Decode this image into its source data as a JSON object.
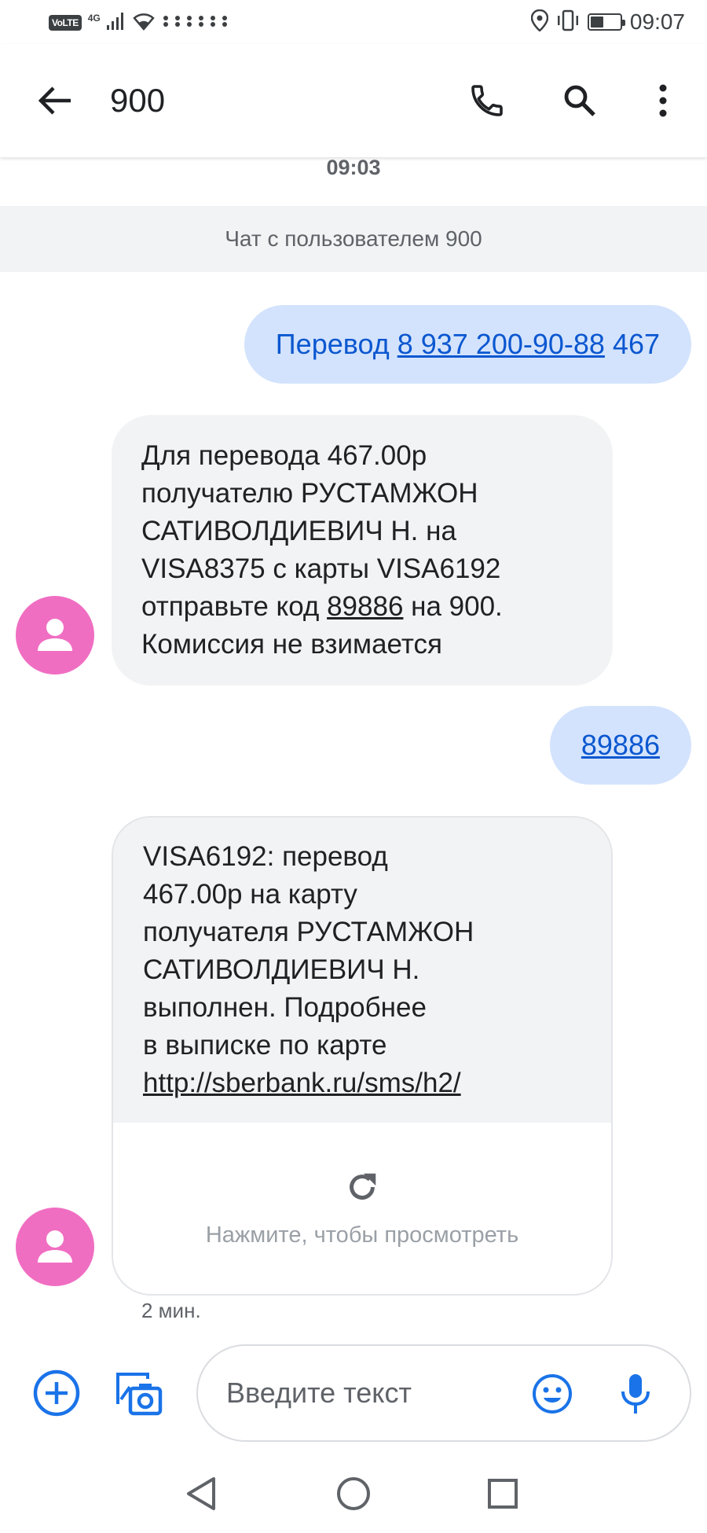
{
  "status_bar": {
    "volte": "VoLTE",
    "network": "4G",
    "time": "09:07",
    "battery_level": 0.45
  },
  "header": {
    "title": "900"
  },
  "conversation": {
    "timestamp_top": "09:03",
    "banner": "Чат с пользователем 900",
    "messages": [
      {
        "direction": "outgoing",
        "prefix": "Перевод ",
        "link": "8 937 200-90-88",
        "suffix": " 467"
      },
      {
        "direction": "incoming",
        "lines": [
          "Для перевода 467.00р",
          "получателю РУСТАМЖОН",
          "САТИВОЛДИЕВИЧ Н. на",
          "VISA8375 с карты VISA6192"
        ],
        "code_prefix": "отправьте код ",
        "code": "89886",
        "code_suffix": " на 900.",
        "last_line": "Комиссия не взимается"
      },
      {
        "direction": "outgoing",
        "link": "89886"
      },
      {
        "direction": "incoming",
        "lines": [
          "VISA6192: перевод",
          "467.00р на карту",
          "получателя РУСТАМЖОН",
          "САТИВОЛДИЕВИЧ Н.",
          "выполнен. Подробнее",
          "в выписке по карте"
        ],
        "url": "http://sberbank.ru/sms/h2/",
        "preview_text": "Нажмите, чтобы просмотреть",
        "time": "2 мин."
      }
    ]
  },
  "compose": {
    "placeholder": "Введите текст"
  },
  "colors": {
    "accent": "#1a73e8",
    "avatar": "#f06ec2",
    "outgoing_bubble": "#d3e3fd",
    "incoming_bubble": "#f1f3f4"
  }
}
